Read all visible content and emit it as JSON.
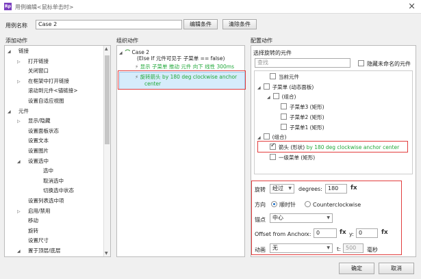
{
  "window": {
    "icon": "Rp",
    "title": "用例编辑<鼠标单击时>",
    "close": "×"
  },
  "case_name": {
    "label": "用例名称",
    "value": "Case 2",
    "edit_btn": "编辑条件",
    "clear_btn": "清除条件"
  },
  "panels": {
    "add_action": "添加动作",
    "organize_action": "组织动作",
    "config_action": "配置动作"
  },
  "add_action_tree": [
    {
      "text": "链接",
      "level": 0,
      "tri": "◢"
    },
    {
      "text": "打开链接",
      "level": 1,
      "tri": "▷"
    },
    {
      "text": "关闭窗口",
      "level": 1,
      "tri": ""
    },
    {
      "text": "在框架中打开链接",
      "level": 1,
      "tri": "▷"
    },
    {
      "text": "滚动到元件<锚链接>",
      "level": 1,
      "tri": ""
    },
    {
      "text": "设置自适应视图",
      "level": 1,
      "tri": ""
    },
    {
      "text": "元件",
      "level": 0,
      "tri": "◢"
    },
    {
      "text": "显示/隐藏",
      "level": 1,
      "tri": "▷"
    },
    {
      "text": "设置面板状态",
      "level": 1,
      "tri": ""
    },
    {
      "text": "设置文本",
      "level": 1,
      "tri": ""
    },
    {
      "text": "设置图片",
      "level": 1,
      "tri": ""
    },
    {
      "text": "设置选中",
      "level": 1,
      "tri": "◢"
    },
    {
      "text": "选中",
      "level": 2,
      "tri": ""
    },
    {
      "text": "取消选中",
      "level": 2,
      "tri": ""
    },
    {
      "text": "切换选中状态",
      "level": 2,
      "tri": ""
    },
    {
      "text": "设置列表选中项",
      "level": 1,
      "tri": ""
    },
    {
      "text": "启用/禁用",
      "level": 1,
      "tri": "▷"
    },
    {
      "text": "移动",
      "level": 1,
      "tri": ""
    },
    {
      "text": "旋转",
      "level": 1,
      "tri": ""
    },
    {
      "text": "设置尺寸",
      "level": 1,
      "tri": ""
    },
    {
      "text": "置于顶层/底层",
      "level": 1,
      "tri": "◢"
    }
  ],
  "organize": {
    "case_title": "Case 2",
    "case_condition": "(Else If 元件可见于 子菜单 == false)",
    "action1": "显示 子菜单 推动 元件 向下 线性 300ms",
    "action2_line1": "旋转箭头 by 180 deg clockwise anchor",
    "action2_line2": "center"
  },
  "config": {
    "select_label": "选择旋转的元件",
    "search_placeholder": "查找",
    "hide_unnamed": "隐藏未命名的元件",
    "tree": [
      {
        "text": "当前元件",
        "checked": false,
        "tri": ""
      },
      {
        "text": "子菜单 (动态面板)",
        "checked": false,
        "tri": "◢"
      },
      {
        "text": "(组合)",
        "checked": false,
        "tri": "◢"
      },
      {
        "text": "子菜单3 (矩形)",
        "checked": false,
        "tri": ""
      },
      {
        "text": "子菜单2 (矩形)",
        "checked": false,
        "tri": ""
      },
      {
        "text": "子菜单1 (矩形)",
        "checked": false,
        "tri": ""
      },
      {
        "text": "(组合)",
        "checked": false,
        "tri": "◢"
      },
      {
        "text": "箭头 (形状)",
        "checked": true,
        "tri": "",
        "suffix": " by 180 deg clockwise anchor center"
      },
      {
        "text": "一级菜单 (矩形)",
        "checked": false,
        "tri": ""
      }
    ],
    "rotate_label": "旋转",
    "rotate_mode": "经过",
    "degrees_label": "degrees:",
    "degrees_value": "180",
    "fx": "fx",
    "direction_label": "方向",
    "clockwise": "顺时针",
    "counterclockwise": "Counterclockwise",
    "anchor_label": "锚点",
    "anchor_value": "中心",
    "offset_label": "Offset from Anchor",
    "x_label": "x:",
    "x_value": "0",
    "y_label": "y:",
    "y_value": "0",
    "anim_label": "动画",
    "anim_value": "无",
    "t_label": "t:",
    "t_value": "500",
    "ms_label": "毫秒"
  },
  "footer": {
    "ok": "确定",
    "cancel": "取消"
  },
  "colors": {
    "accent_green": "#21a83a",
    "highlight_red": "#e23c3c",
    "selection_blue": "#d6ecfb"
  }
}
